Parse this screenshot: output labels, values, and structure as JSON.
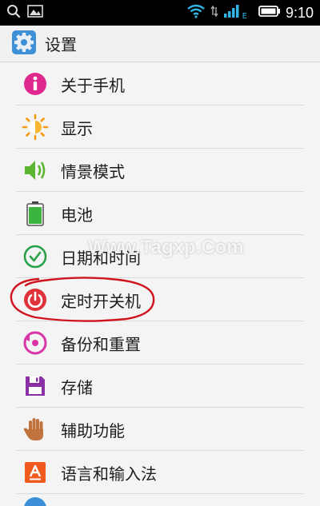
{
  "status_bar": {
    "time": "9:10",
    "icons": [
      "search-icon",
      "image-icon",
      "wifi-icon",
      "signal-icon",
      "battery-icon"
    ],
    "network_type": "E"
  },
  "header": {
    "title": "设置",
    "icon": "settings-gear-icon"
  },
  "settings_list": {
    "items": [
      {
        "label": "关于手机",
        "icon": "info-icon",
        "color": "#e0298f"
      },
      {
        "label": "显示",
        "icon": "sun-icon",
        "color": "#f39c12"
      },
      {
        "label": "情景模式",
        "icon": "speaker-icon",
        "color": "#5bb531"
      },
      {
        "label": "电池",
        "icon": "battery-icon",
        "color": "#3cb53e"
      },
      {
        "label": "日期和时间",
        "icon": "clock-icon",
        "color": "#2aa24a"
      },
      {
        "label": "定时开关机",
        "icon": "power-icon",
        "color": "#e0323a"
      },
      {
        "label": "备份和重置",
        "icon": "restore-icon",
        "color": "#d935a6"
      },
      {
        "label": "存储",
        "icon": "floppy-disk-icon",
        "color": "#8b2fa4"
      },
      {
        "label": "辅助功能",
        "icon": "hand-icon",
        "color": "#c0733d"
      },
      {
        "label": "语言和输入法",
        "icon": "language-icon",
        "color": "#f05a1e"
      }
    ]
  },
  "watermark": "Www.Tagxp.Com",
  "annotation": {
    "circled_item": "定时开关机",
    "color": "#d0141f"
  }
}
